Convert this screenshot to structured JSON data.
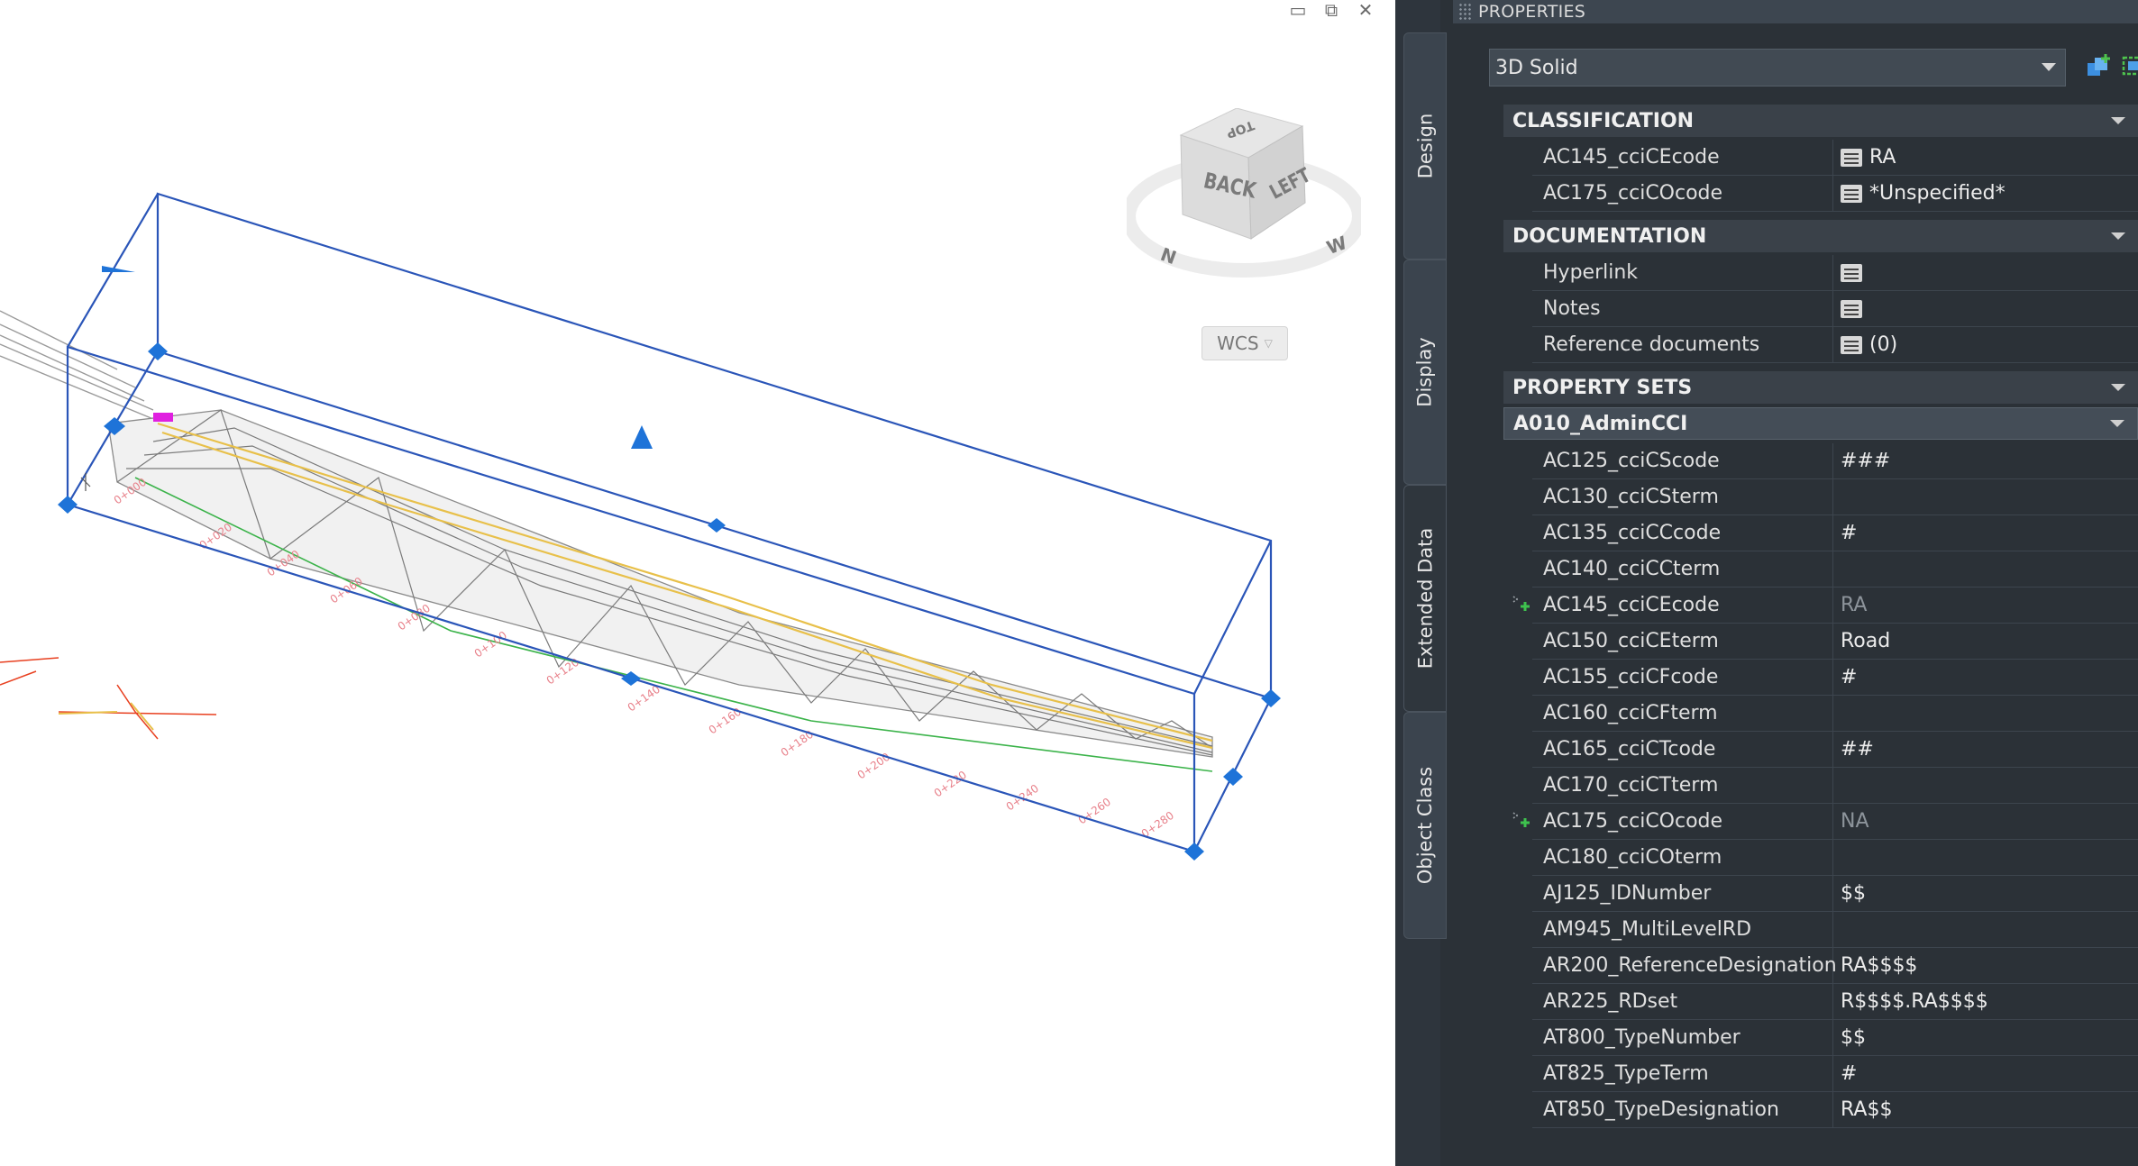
{
  "window_controls": {
    "minimize": "▭",
    "restore": "⧉",
    "close": "✕"
  },
  "viewcube": {
    "faces": {
      "top": "TOP",
      "back": "BACK",
      "left": "LEFT"
    },
    "compass": {
      "north": "N",
      "west": "W"
    },
    "wcs_label": "WCS"
  },
  "palette": {
    "title": "PROPERTIES",
    "side_tabs": [
      "Design",
      "Display",
      "Extended Data",
      "Object Class"
    ],
    "active_tab": "Extended Data",
    "object_type": "3D Solid",
    "toolbar_icons": [
      "add-selected-icon",
      "quick-select-icon",
      "select-objects-icon"
    ],
    "classification": {
      "header": "CLASSIFICATION",
      "rows": [
        {
          "name": "AC145_cciCEcode",
          "value": "RA"
        },
        {
          "name": "AC175_cciCOcode",
          "value": "*Unspecified*"
        }
      ]
    },
    "documentation": {
      "header": "DOCUMENTATION",
      "rows": [
        {
          "name": "Hyperlink",
          "value": ""
        },
        {
          "name": "Notes",
          "value": ""
        },
        {
          "name": "Reference documents",
          "value": "(0)"
        }
      ]
    },
    "property_sets": {
      "header": "PROPERTY SETS",
      "set_name": "A010_AdminCCI",
      "rows": [
        {
          "name": "AC125_cciCScode",
          "value": "###"
        },
        {
          "name": "AC130_cciCSterm",
          "value": ""
        },
        {
          "name": "AC135_cciCCcode",
          "value": "#"
        },
        {
          "name": "AC140_cciCCterm",
          "value": ""
        },
        {
          "name": "AC145_cciCEcode",
          "value": "RA"
        },
        {
          "name": "AC150_cciCEterm",
          "value": "Road"
        },
        {
          "name": "AC155_cciCFcode",
          "value": "#"
        },
        {
          "name": "AC160_cciCFterm",
          "value": ""
        },
        {
          "name": "AC165_cciCTcode",
          "value": "##"
        },
        {
          "name": "AC170_cciCTterm",
          "value": ""
        },
        {
          "name": "AC175_cciCOcode",
          "value": "NA"
        },
        {
          "name": "AC180_cciCOterm",
          "value": ""
        },
        {
          "name": "AJ125_IDNumber",
          "value": "$$"
        },
        {
          "name": "AM945_MultiLevelRD",
          "value": ""
        },
        {
          "name": "AR200_ReferenceDesignation",
          "value": "RA$$$$"
        },
        {
          "name": "AR225_RDset",
          "value": "R$$$$.RA$$$$"
        },
        {
          "name": "AT800_TypeNumber",
          "value": "$$"
        },
        {
          "name": "AT825_TypeTerm",
          "value": "#"
        },
        {
          "name": "AT850_TypeDesignation",
          "value": "RA$$"
        }
      ]
    }
  }
}
